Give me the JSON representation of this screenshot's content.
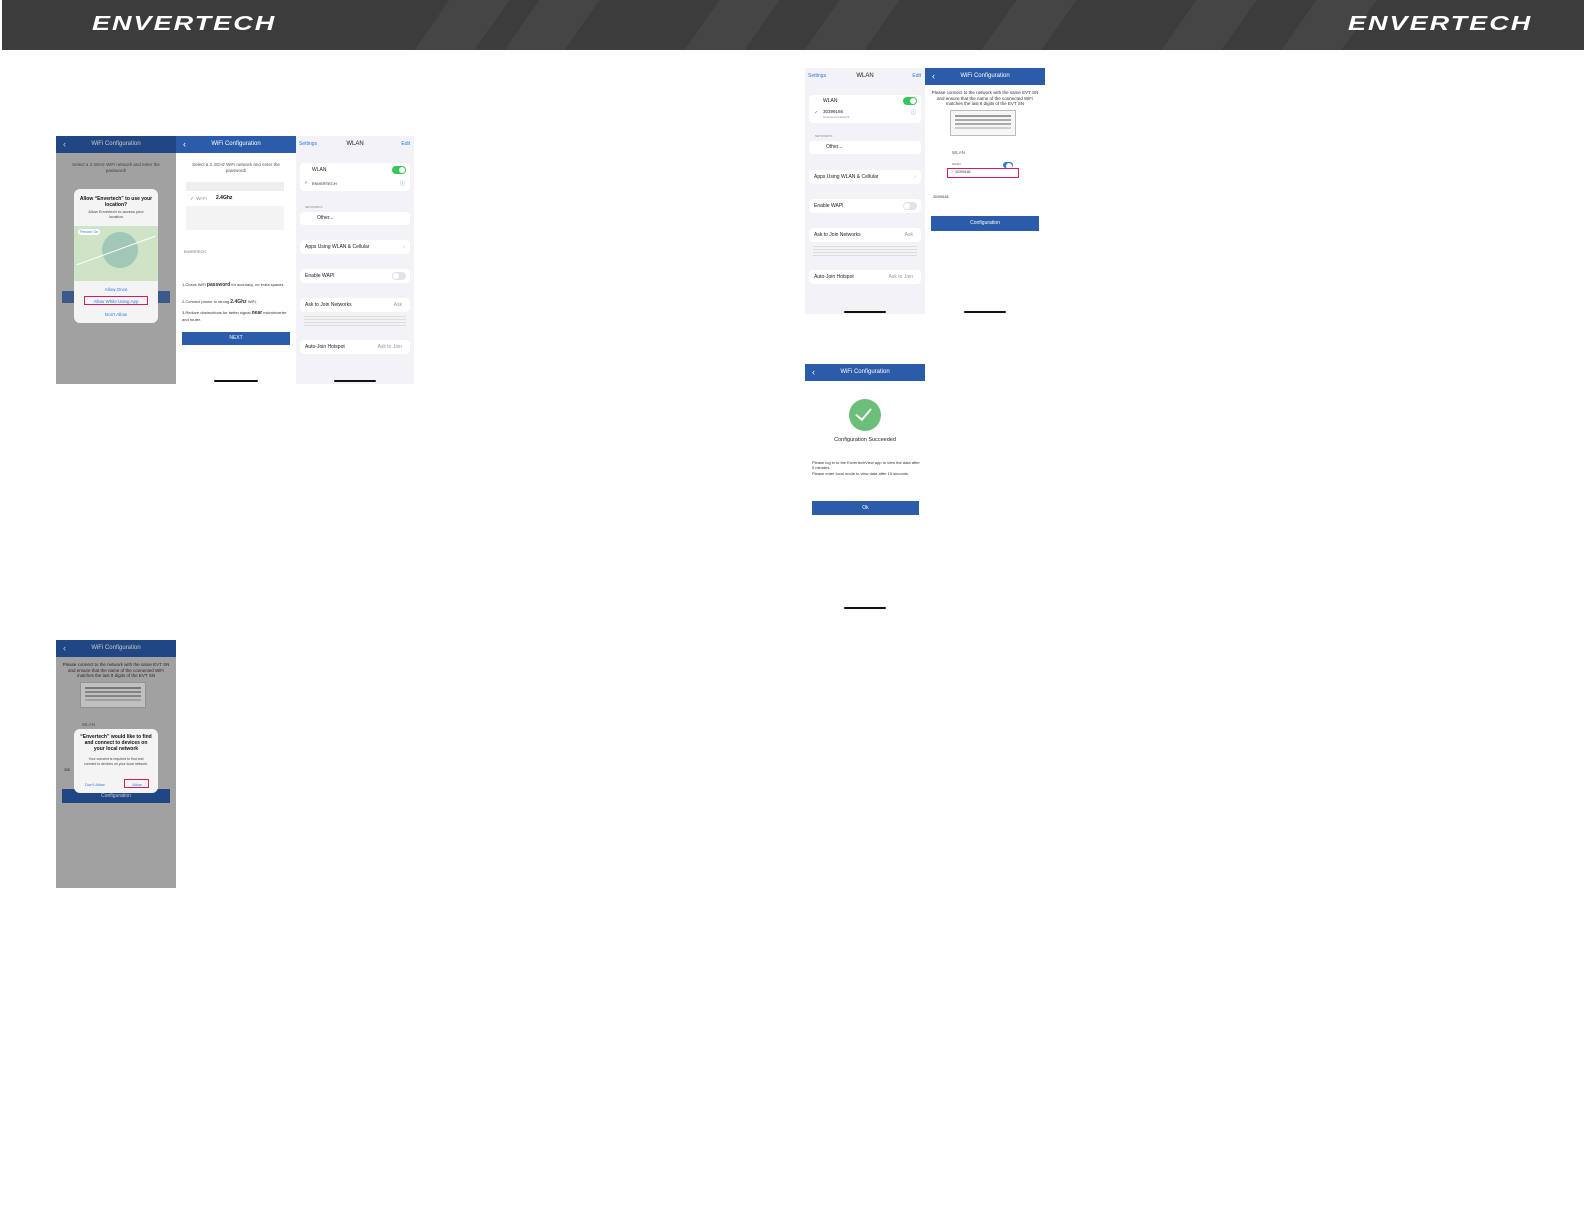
{
  "brand": {
    "logo_left": "ENVERTECH",
    "logo_right": "ENVERTECH"
  },
  "screen1": {
    "title": "WiFi Configuration",
    "instruction": "Select a 2.4GHz WiFi network and enter the password!",
    "dialog_title": "Allow “Envertech” to use your location?",
    "dialog_sub": "Allow Envertech to access your location",
    "map_tag": "Precise: On",
    "option_once": "Allow Once",
    "option_while": "Allow While Using App",
    "option_deny": "Don't Allow"
  },
  "screen2": {
    "title": "WiFi Configuration",
    "instruction": "Select a 2.4GHz WiFi network and enter the password!",
    "wifi_label": "Wi-Fi",
    "wifi_name": "2.4Ghz",
    "network_name": "ENVERTECH",
    "note1_prefix": "1.Check WiFi",
    "note1_bold": "password",
    "note1_suffix": "for accuracy, no extra spaces.",
    "note2_prefix": "2.Connect phone to strong",
    "note2_bold": "2.4Ghz",
    "note2_suffix": "WiFi.",
    "note3_prefix": "3.Reduce obstructions for better signal",
    "note3_bold": "near",
    "note3_suffix": "microinverter and router.",
    "next_label": "NEXT"
  },
  "screen3": {
    "back": "Settings",
    "title": "WLAN",
    "edit": "Edit",
    "wlan": "WLAN",
    "network": "ENVERTECH",
    "networks_header": "NETWORKS",
    "other": "Other...",
    "apps": "Apps Using WLAN & Cellular",
    "wapi": "Enable WAPI",
    "ask_join": "Ask to Join Networks",
    "ask_value": "Ask",
    "auto_join": "Auto-Join Hotspot",
    "auto_value": "Ask to Join"
  },
  "screen4": {
    "title": "WiFi Configuration",
    "instruction": "Please connect to the network with the same EVT SN and ensure that the name of the connected WiFi matches the last 8 digits of the EVT SN",
    "wlan_label": "WLAN",
    "sn_prefix": "308",
    "dialog_title": "“Envertech” would like to find and connect to devices on your local network",
    "dialog_body": "Your consent is required to find and connect to devices on your local network.",
    "dont_allow": "Don't Allow",
    "allow": "Allow",
    "config_label": "Configuration"
  },
  "screen5": {
    "back": "Settings",
    "title": "WLAN",
    "edit": "Edit",
    "wlan": "WLAN",
    "network": "30399166",
    "network_sub": "Unsecured Network",
    "networks_header": "NETWORKS",
    "other": "Other...",
    "apps": "Apps Using WLAN & Cellular",
    "wapi": "Enable WAPI",
    "ask_join": "Ask to Join Networks",
    "ask_value": "Ask",
    "auto_join": "Auto-Join Hotspot",
    "auto_value": "Ask to Join"
  },
  "screen6": {
    "title": "WiFi Configuration",
    "instruction": "Please connect to the network with the same EVT SN and ensure that the name of the connected WiFi matches the last 8 digits of the EVT SN",
    "wlan_label": "WLAN",
    "wlan_small": "WLAN",
    "ssid": "30399166",
    "sn_row": "30399166",
    "config_label": "Configuration"
  },
  "screen7": {
    "title": "WiFi Configuration",
    "status": "Configuration Succeeded",
    "line1": "Please log in to the EnvertechView app to view the data after 5 minutes.",
    "line2": "Please enter local mode to view data after 15 seconds.",
    "ok_label": "Ok"
  },
  "colors": {
    "header_bg": "#3c3c3c",
    "app_blue": "#2a5caa",
    "success_green": "#6bbf7a",
    "highlight_red": "#d81b60",
    "ios_green": "#34c759"
  }
}
